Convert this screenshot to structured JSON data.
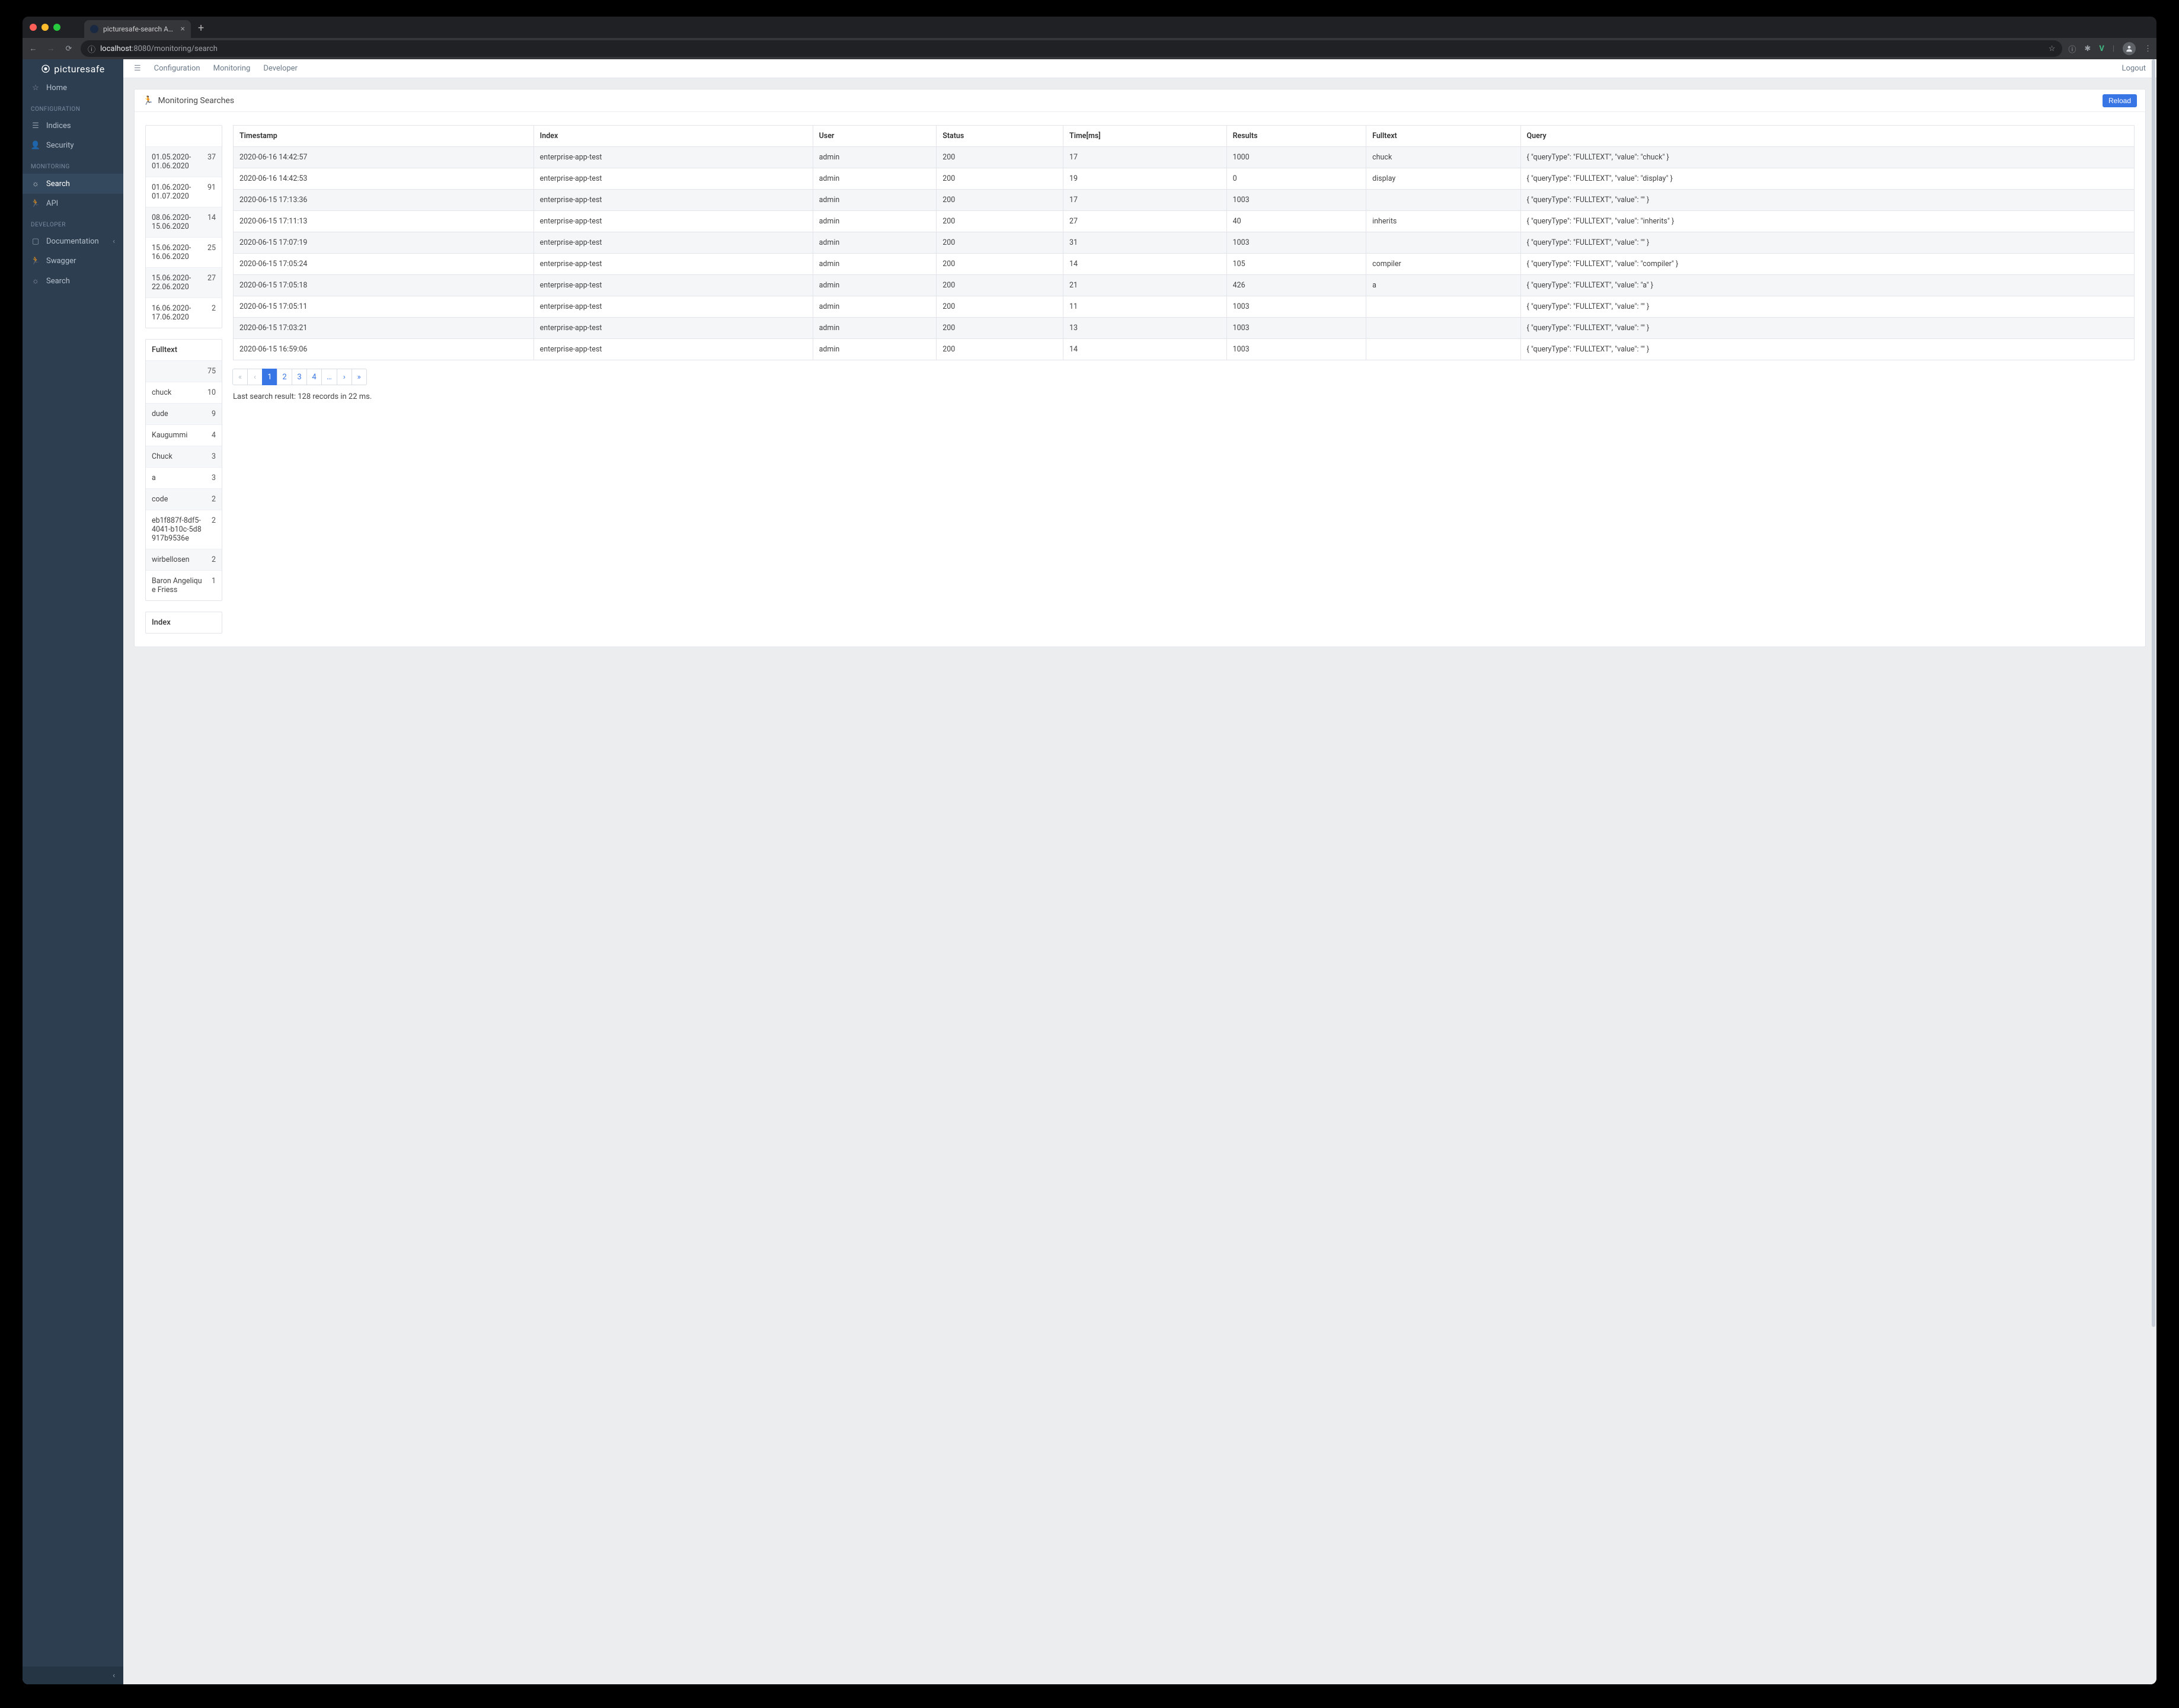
{
  "browser": {
    "tab_title": "picturesafe-search Acceleratio",
    "url_host": "localhost",
    "url_port": ":8080",
    "url_path": "/monitoring/search"
  },
  "brand": "picturesafe",
  "sidebar": {
    "home": "Home",
    "sections": {
      "configuration": "CONFIGURATION",
      "monitoring": "MONITORING",
      "developer": "DEVELOPER"
    },
    "items": {
      "indices": "Indices",
      "security": "Security",
      "search": "Search",
      "api": "API",
      "documentation": "Documentation",
      "swagger": "Swagger",
      "dev_search": "Search"
    }
  },
  "topnav": {
    "configuration": "Configuration",
    "monitoring": "Monitoring",
    "developer": "Developer",
    "logout": "Logout"
  },
  "panel": {
    "title": "Monitoring Searches",
    "reload": "Reload"
  },
  "facets": {
    "date_ranges": [
      {
        "label": "01.05.2020-01.06.2020",
        "count": 37
      },
      {
        "label": "01.06.2020-01.07.2020",
        "count": 91
      },
      {
        "label": "08.06.2020-15.06.2020",
        "count": 14
      },
      {
        "label": "15.06.2020-16.06.2020",
        "count": 25
      },
      {
        "label": "15.06.2020-22.06.2020",
        "count": 27
      },
      {
        "label": "16.06.2020-17.06.2020",
        "count": 2
      }
    ],
    "fulltext_title": "Fulltext",
    "fulltext": [
      {
        "label": "",
        "count": 75
      },
      {
        "label": "chuck",
        "count": 10
      },
      {
        "label": "dude",
        "count": 9
      },
      {
        "label": "Kaugummi",
        "count": 4
      },
      {
        "label": "Chuck",
        "count": 3
      },
      {
        "label": "a",
        "count": 3
      },
      {
        "label": "code",
        "count": 2
      },
      {
        "label": "eb1f887f-8df5-4041-b10c-5d8917b9536e",
        "count": 2
      },
      {
        "label": "wirbellosen",
        "count": 2
      },
      {
        "label": "Baron Angelique Friess",
        "count": 1
      }
    ],
    "index_title": "Index"
  },
  "table": {
    "headers": {
      "timestamp": "Timestamp",
      "index": "Index",
      "user": "User",
      "status": "Status",
      "time_ms": "Time[ms]",
      "results": "Results",
      "fulltext": "Fulltext",
      "query": "Query"
    },
    "rows": [
      {
        "timestamp": "2020-06-16 14:42:57",
        "index": "enterprise-app-test",
        "user": "admin",
        "status": "200",
        "time_ms": "17",
        "results": "1000",
        "fulltext": "chuck",
        "query": "{ \"queryType\": \"FULLTEXT\", \"value\": \"chuck\" }"
      },
      {
        "timestamp": "2020-06-16 14:42:53",
        "index": "enterprise-app-test",
        "user": "admin",
        "status": "200",
        "time_ms": "19",
        "results": "0",
        "fulltext": "display",
        "query": "{ \"queryType\": \"FULLTEXT\", \"value\": \"display\" }"
      },
      {
        "timestamp": "2020-06-15 17:13:36",
        "index": "enterprise-app-test",
        "user": "admin",
        "status": "200",
        "time_ms": "17",
        "results": "1003",
        "fulltext": "",
        "query": "{ \"queryType\": \"FULLTEXT\", \"value\": \"\" }"
      },
      {
        "timestamp": "2020-06-15 17:11:13",
        "index": "enterprise-app-test",
        "user": "admin",
        "status": "200",
        "time_ms": "27",
        "results": "40",
        "fulltext": "inherits",
        "query": "{ \"queryType\": \"FULLTEXT\", \"value\": \"inherits\" }"
      },
      {
        "timestamp": "2020-06-15 17:07:19",
        "index": "enterprise-app-test",
        "user": "admin",
        "status": "200",
        "time_ms": "31",
        "results": "1003",
        "fulltext": "",
        "query": "{ \"queryType\": \"FULLTEXT\", \"value\": \"\" }"
      },
      {
        "timestamp": "2020-06-15 17:05:24",
        "index": "enterprise-app-test",
        "user": "admin",
        "status": "200",
        "time_ms": "14",
        "results": "105",
        "fulltext": "compiler",
        "query": "{ \"queryType\": \"FULLTEXT\", \"value\": \"compiler\" }"
      },
      {
        "timestamp": "2020-06-15 17:05:18",
        "index": "enterprise-app-test",
        "user": "admin",
        "status": "200",
        "time_ms": "21",
        "results": "426",
        "fulltext": "a",
        "query": "{ \"queryType\": \"FULLTEXT\", \"value\": \"a\" }"
      },
      {
        "timestamp": "2020-06-15 17:05:11",
        "index": "enterprise-app-test",
        "user": "admin",
        "status": "200",
        "time_ms": "11",
        "results": "1003",
        "fulltext": "",
        "query": "{ \"queryType\": \"FULLTEXT\", \"value\": \"\" }"
      },
      {
        "timestamp": "2020-06-15 17:03:21",
        "index": "enterprise-app-test",
        "user": "admin",
        "status": "200",
        "time_ms": "13",
        "results": "1003",
        "fulltext": "",
        "query": "{ \"queryType\": \"FULLTEXT\", \"value\": \"\" }"
      },
      {
        "timestamp": "2020-06-15 16:59:06",
        "index": "enterprise-app-test",
        "user": "admin",
        "status": "200",
        "time_ms": "14",
        "results": "1003",
        "fulltext": "",
        "query": "{ \"queryType\": \"FULLTEXT\", \"value\": \"\" }"
      }
    ]
  },
  "pagination": {
    "pages": [
      "1",
      "2",
      "3",
      "4",
      "…"
    ],
    "active": "1"
  },
  "summary": "Last search result: 128 records in 22 ms."
}
